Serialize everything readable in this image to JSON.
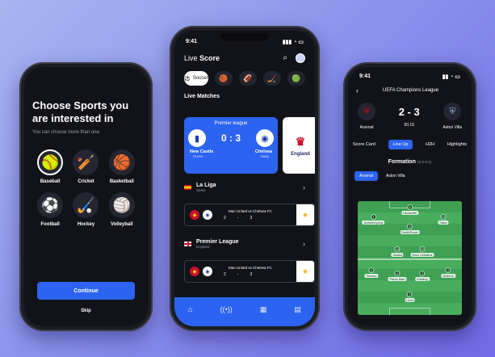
{
  "phone1": {
    "title": "Choose Sports you are interested in",
    "subtitle": "You can choose more than one.",
    "sports": [
      {
        "label": "Baseball",
        "icon": "🥎",
        "selected": true
      },
      {
        "label": "Cricket",
        "icon": "🏏"
      },
      {
        "label": "Basketball",
        "icon": "🏀"
      },
      {
        "label": "Football",
        "icon": "⚽"
      },
      {
        "label": "Hockey",
        "icon": "🏑"
      },
      {
        "label": "Volleyball",
        "icon": "🏐"
      }
    ],
    "continue_label": "Continue",
    "skip_label": "Skip"
  },
  "phone2": {
    "time": "9:41",
    "title_a": "Live",
    "title_b": "Score",
    "chips": [
      {
        "label": "Soccer",
        "icon": "⚽"
      },
      {
        "icon": "🏀"
      },
      {
        "icon": "🏈"
      },
      {
        "icon": "🏒"
      },
      {
        "icon": "🟢"
      }
    ],
    "live_matches_label": "Live Matches",
    "live_card": {
      "league": "Premier league",
      "home": "New Castle",
      "away": "Chelsea",
      "score": "0 : 3",
      "home_tag": "Home",
      "away_tag": "Away"
    },
    "side_card": "England",
    "leagues": [
      {
        "name": "La Liga",
        "country": "Spain",
        "home": "Man United",
        "away": "vs Chelsea FC",
        "hs": "2",
        "sep": "-",
        "as": "3"
      },
      {
        "name": "Premier League",
        "country": "England",
        "home": "Man United",
        "away": "vs Chelsea FC",
        "hs": "2",
        "sep": "-",
        "as": "3"
      }
    ],
    "accent": "#2c63f0"
  },
  "phone3": {
    "time": "9:41",
    "competition": "UEFA Champions League",
    "home": "Arsenal",
    "away": "Aston Villa",
    "score": "2 - 3",
    "time_label": "50.15",
    "tabs": [
      "Score Card",
      "Line Up",
      "H2H",
      "Highlights"
    ],
    "active_tab": "Line Up",
    "formation_label": "Formation",
    "formation": "(4-2-3-1)",
    "team_tabs": [
      "Arsenal",
      "Aston Villa"
    ],
    "players": [
      {
        "num": "9",
        "name": "Lacazette"
      },
      {
        "num": "7",
        "name": "Aubameyang"
      },
      {
        "num": "19",
        "name": "Saka"
      },
      {
        "num": "8",
        "name": "SmithRowe"
      },
      {
        "num": "34",
        "name": "Xhaka"
      },
      {
        "num": "25",
        "name": "Dani Ceballos"
      },
      {
        "num": "3",
        "name": "Tierney"
      },
      {
        "num": "4",
        "name": "Pablo Mari"
      },
      {
        "num": "2",
        "name": "Holding"
      },
      {
        "num": "2",
        "name": "Bellerin"
      },
      {
        "num": "1",
        "name": "Leno"
      }
    ]
  }
}
